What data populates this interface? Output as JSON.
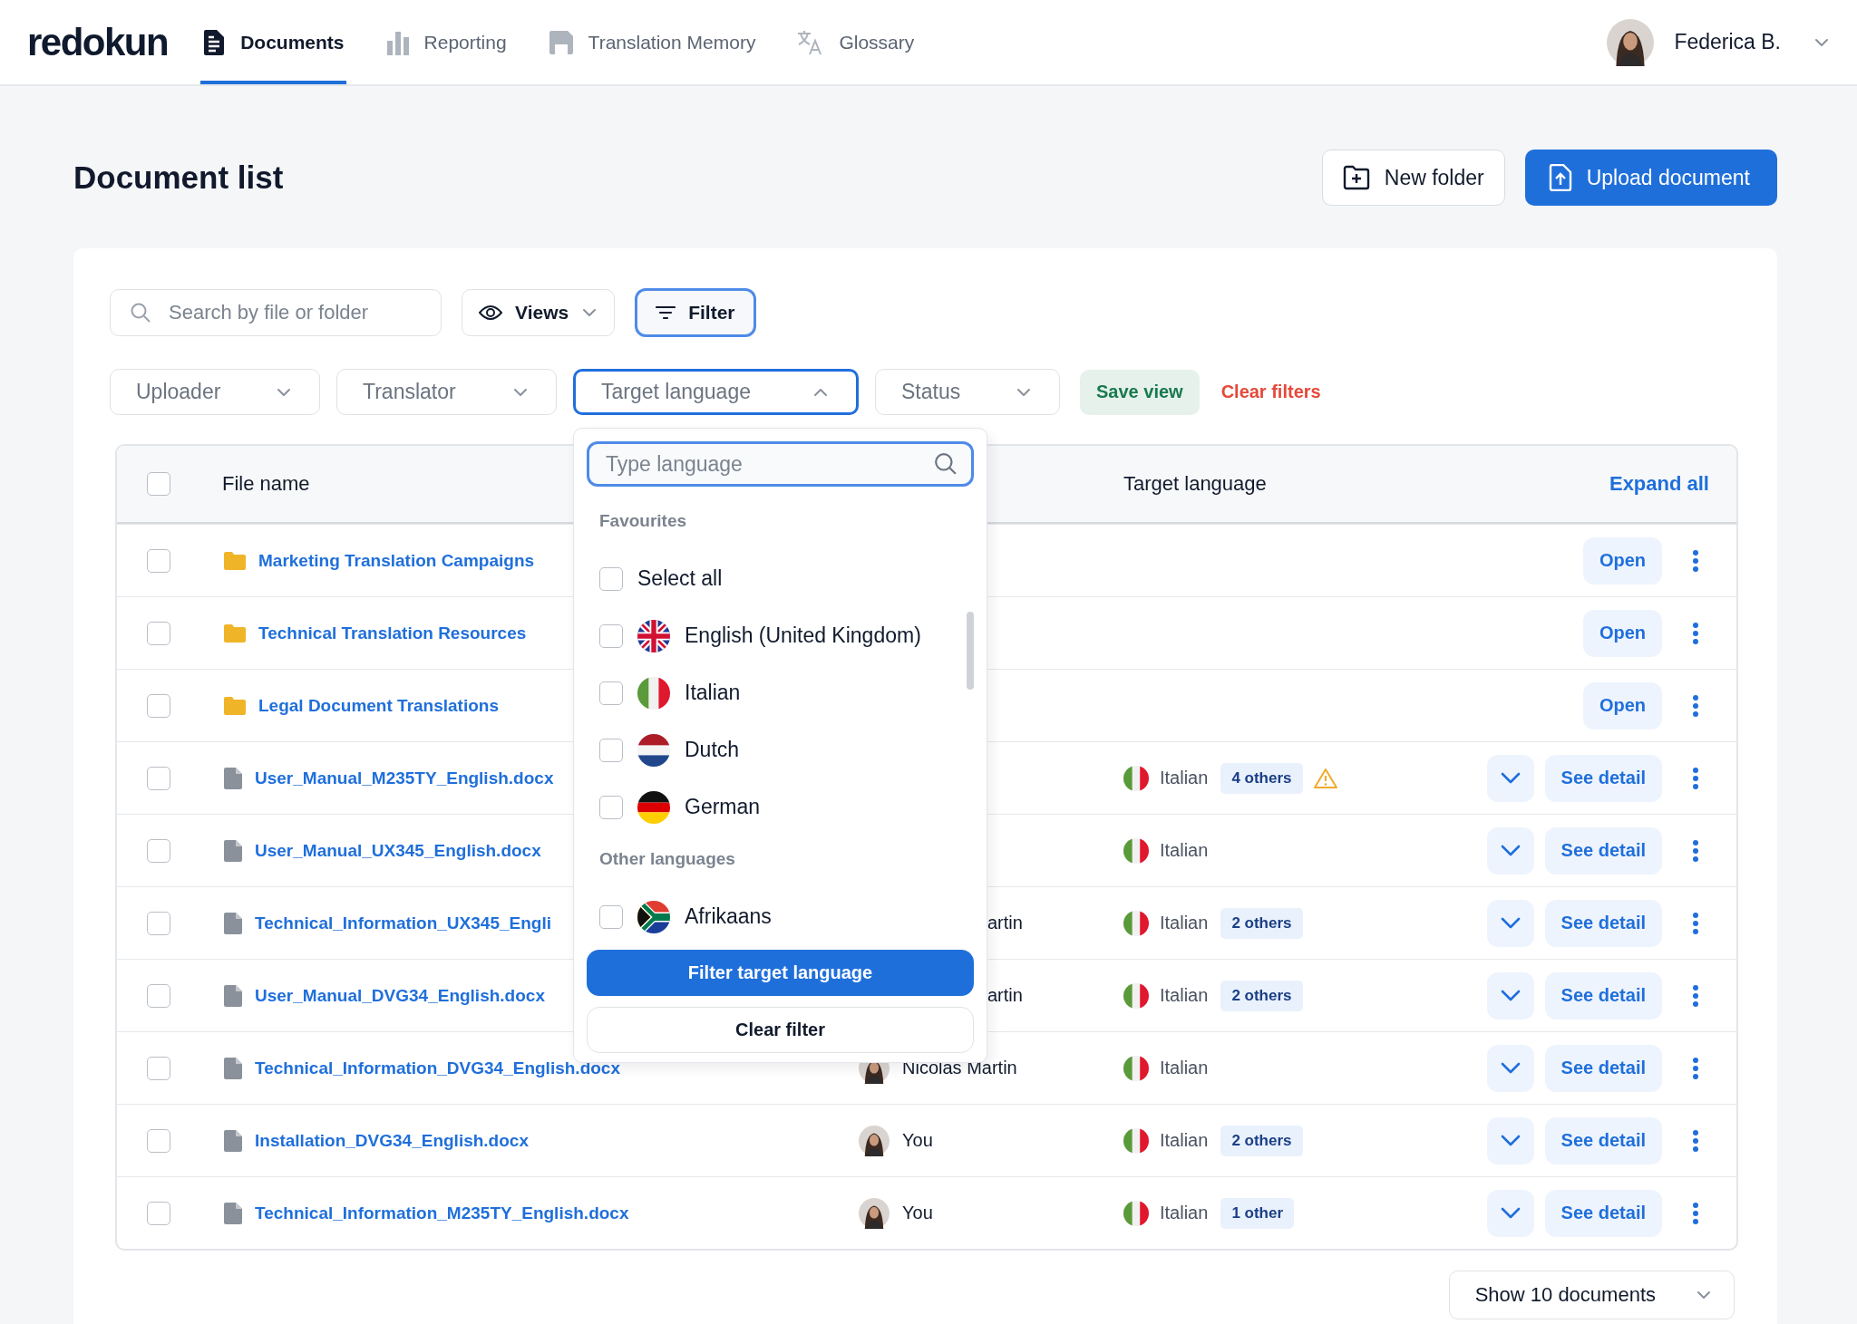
{
  "nav": {
    "logo": "redokun",
    "tabs": [
      {
        "label": "Documents",
        "selected": true
      },
      {
        "label": "Reporting",
        "selected": false
      },
      {
        "label": "Translation Memory",
        "selected": false
      },
      {
        "label": "Glossary",
        "selected": false
      }
    ],
    "user": {
      "name": "Federica B."
    }
  },
  "page": {
    "title": "Document list",
    "buttons": [
      {
        "label": "New folder",
        "kind": "secondary"
      },
      {
        "label": "Upload document",
        "kind": "primary"
      }
    ]
  },
  "toolbar": {
    "search": {
      "placeholder": "Search by file or folder"
    },
    "views": "Views",
    "filter": {
      "label": "Filter",
      "active": true
    }
  },
  "filters": [
    {
      "label": "Uploader",
      "open": false
    },
    {
      "label": "Translator",
      "open": false
    },
    {
      "label": "Target language",
      "open": true
    },
    {
      "label": "Status",
      "open": false
    }
  ],
  "save_view": "Save view",
  "clear_filters": "Clear filters",
  "table": {
    "select_all_checked": false,
    "columns": [
      "File name",
      "Target language"
    ],
    "expand_all": "Expand all",
    "rows": [
      {
        "kind": "folder",
        "name": "Marketing Translation Campaigns",
        "checked": false,
        "action": "Open"
      },
      {
        "kind": "folder",
        "name": "Technical Translation Resources",
        "checked": false,
        "action": "Open"
      },
      {
        "kind": "folder",
        "name": "Legal Document Translations",
        "checked": false,
        "action": "Open"
      },
      {
        "kind": "file",
        "name": "User_Manual_M235TY_English.docx",
        "checked": false,
        "target": {
          "language": "Italian",
          "others": "4 others",
          "warning": true
        },
        "action": "See detail"
      },
      {
        "kind": "file",
        "name": "User_Manual_UX345_English.docx",
        "checked": false,
        "target": {
          "language": "Italian",
          "warning": false
        },
        "action": "See detail"
      },
      {
        "kind": "file",
        "name": "Technical_Information_UX345_Engli",
        "checked": false,
        "translator": {
          "name": "artin",
          "avatar": false
        },
        "target": {
          "language": "Italian",
          "others": "2 others",
          "warning": false
        },
        "action": "See detail"
      },
      {
        "kind": "file",
        "name": "User_Manual_DVG34_English.docx",
        "checked": false,
        "translator": {
          "name": "artin",
          "avatar": false
        },
        "target": {
          "language": "Italian",
          "others": "2 others",
          "warning": false
        },
        "action": "See detail"
      },
      {
        "kind": "file",
        "name": "Technical_Information_DVG34_English.docx",
        "checked": false,
        "translator": {
          "name": "Nicolas Martin",
          "avatar": true
        },
        "target": {
          "language": "Italian",
          "warning": false
        },
        "action": "See detail"
      },
      {
        "kind": "file",
        "name": "Installation_DVG34_English.docx",
        "checked": false,
        "translator": {
          "name": "You",
          "avatar": true
        },
        "target": {
          "language": "Italian",
          "others": "2 others",
          "warning": false
        },
        "action": "See detail"
      },
      {
        "kind": "file",
        "name": "Technical_Information_M235TY_English.docx",
        "checked": false,
        "translator": {
          "name": "You",
          "avatar": true
        },
        "target": {
          "language": "Italian",
          "others": "1 other",
          "warning": false
        },
        "action": "See detail"
      }
    ]
  },
  "dropdown": {
    "search": {
      "placeholder": "Type language"
    },
    "groups": [
      {
        "title": "Favourites",
        "items": [
          {
            "label": "Select all",
            "kind": "all",
            "checked": false
          },
          {
            "label": "English (United Kingdom)",
            "kind": "uk",
            "checked": false
          },
          {
            "label": "Italian",
            "kind": "italy",
            "checked": false
          },
          {
            "label": "Dutch",
            "kind": "netherlands",
            "checked": false
          },
          {
            "label": "German",
            "kind": "germany",
            "checked": false
          }
        ]
      },
      {
        "title": "Other languages",
        "items": [
          {
            "label": "Afrikaans",
            "kind": "southafrica",
            "checked": false
          }
        ]
      }
    ],
    "apply": "Filter target language",
    "clear": "Clear filter"
  },
  "page_size": "Show 10 documents"
}
